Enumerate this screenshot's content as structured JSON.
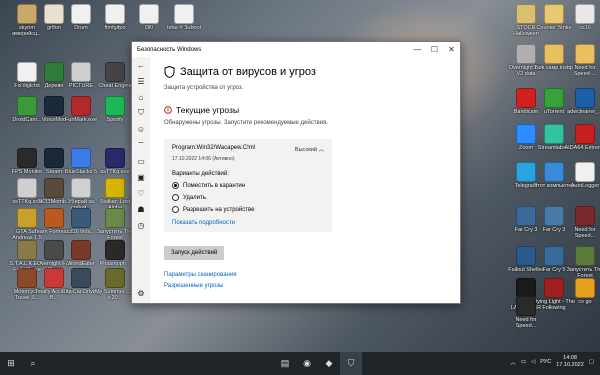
{
  "desktop": {
    "icons": [
      {
        "label": "skyrim имерийсц...",
        "color": "#c9a86a"
      },
      {
        "label": "grlfon",
        "color": "#e8e0d0"
      },
      {
        "label": "Drum",
        "color": "#f0f0f0"
      },
      {
        "label": "ftmfgifpo",
        "color": "#f0f0f0"
      },
      {
        "label": "l3l0",
        "color": "#f0f0f0"
      },
      {
        "label": "tsfac'# 3ubnol",
        "color": "#f0f0f0"
      },
      {
        "label": "STOCR Halloween",
        "color": "#d9c070"
      },
      {
        "label": "Counter Strike",
        "color": "#e8c870"
      },
      {
        "label": "cs16",
        "color": "#e8e8e8"
      },
      {
        "label": "Overnight Full V2 data",
        "color": "#b0b0b0"
      },
      {
        "label": "Бок самр.insttp",
        "color": "#e8c060"
      },
      {
        "label": "Need for Speed-...",
        "color": "#e8c060"
      },
      {
        "label": "Fix'diglctxt",
        "color": "#f0f0f0"
      },
      {
        "label": "Дерево",
        "color": "#2f7d3a"
      },
      {
        "label": "PICTURE",
        "color": "#cfcfcf"
      },
      {
        "label": "Cheat Engine",
        "color": "#444444"
      },
      {
        "label": "Bandicam",
        "color": "#d02020"
      },
      {
        "label": "uTorrent",
        "color": "#36a33a"
      },
      {
        "label": "adwcleaner_...",
        "color": "#1b5fa8"
      },
      {
        "label": "DroidCam...",
        "color": "#3a9a3a"
      },
      {
        "label": "VoiceMod",
        "color": "#1a2a3a"
      },
      {
        "label": "FunMark.exe",
        "color": "#b02a2a"
      },
      {
        "label": "Spotify",
        "color": "#1db954"
      },
      {
        "label": "Zoom",
        "color": "#2d8cff"
      },
      {
        "label": "Streamlabs...",
        "color": "#31c3a2"
      },
      {
        "label": "AIDA64 Extreme",
        "color": "#c42020"
      },
      {
        "label": "FPS Monitor",
        "color": "#2a2a2a"
      },
      {
        "label": "Steam",
        "color": "#1b2838"
      },
      {
        "label": "BlueStacks 5",
        "color": "#3b7be8"
      },
      {
        "label": "ssTTKq.exe",
        "color": "#2a2a6a"
      },
      {
        "label": "Telegram",
        "color": "#2aa3e0"
      },
      {
        "label": "Этот компьютер",
        "color": "#3a8ad8"
      },
      {
        "label": "AutoLogger",
        "color": "#f0f0f0"
      },
      {
        "label": "ssTTKq.exe",
        "color": "#cfcfcf"
      },
      {
        "label": "ЗКЗЗМоmb...",
        "color": "#5a4a3a"
      },
      {
        "label": "Убирай за собой...",
        "color": "#d0d0d0"
      },
      {
        "label": "Stalker: Lost Alpha",
        "color": "#d6b400"
      },
      {
        "label": "Far Cry 3",
        "color": "#3a6a9a"
      },
      {
        "label": "Far Cry 3",
        "color": "#4a7aaa"
      },
      {
        "label": "Need for Speed...",
        "color": "#7a2a2a"
      },
      {
        "label": "GTA San Andreas 1.5",
        "color": "#c8a030"
      },
      {
        "label": "Team Fortress 2",
        "color": "#b85a20"
      },
      {
        "label": "cs16 hlds...",
        "color": "#3a5a7a"
      },
      {
        "label": "Запустить The Forest",
        "color": "#6a8a4a"
      },
      {
        "label": "S.T.A.L.K.E.R. Full V2.exe",
        "color": "#8a7a4a"
      },
      {
        "label": "Overnight Full V2.exe",
        "color": "#4a4a4a"
      },
      {
        "label": "WorldEater",
        "color": "#7a3a2a"
      },
      {
        "label": "Phasmoph...",
        "color": "#2a2a2a"
      },
      {
        "label": "Fallout Shelter",
        "color": "#2a5a8a"
      },
      {
        "label": "Far Cry 5",
        "color": "#3a6a9a"
      },
      {
        "label": "Запустить The Forest",
        "color": "#5a7a3a"
      },
      {
        "label": "Motorcycle Travel S...",
        "color": "#8a4a2a"
      },
      {
        "label": "Totally Accurate B...",
        "color": "#c83a3a"
      },
      {
        "label": "City Car Driving",
        "color": "#3a4a5a"
      },
      {
        "label": "My Summer Car v.20...",
        "color": "#6a6a2a"
      },
      {
        "label": "RAZMIR LAUNCHER",
        "color": "#1a1a1a"
      },
      {
        "label": "Dying Light - The Following",
        "color": "#a02020"
      },
      {
        "label": "cs go",
        "color": "#e8a020"
      },
      {
        "label": "Need for Speed...",
        "color": "#2a2a2a"
      }
    ]
  },
  "window": {
    "title": "Безопасность Windows",
    "minimize_icon": "minimize-icon",
    "maximize_icon": "maximize-icon",
    "close_icon": "close-icon",
    "heading": "Защита от вирусов и угроз",
    "subtitle": "Защита устройства от угроз.",
    "section_title": "Текущие угрозы",
    "section_desc": "Обнаружены угрозы. Запустите рекомендуемые действия.",
    "threat": {
      "name": "Program:Win32/Wacapew.C!ml",
      "severity": "Высокий",
      "date": "17.10.2022 14:06 (Активно)",
      "options_label": "Варианты действий:",
      "options": [
        {
          "label": "Поместить в карантин",
          "selected": true
        },
        {
          "label": "Удалить",
          "selected": false
        },
        {
          "label": "Разрешить на устройстве",
          "selected": false
        }
      ],
      "details_link": "Показать подробности"
    },
    "start_button": "Запуск действий",
    "scan_options_link": "Параметры сканирования",
    "allowed_threats_link": "Разрешенные угрозы"
  },
  "taskbar": {
    "lang": "РУС",
    "time": "14:08",
    "date": "17.10.2022"
  },
  "colors": {
    "link": "#0067c0",
    "taskbar": "#1f2428"
  }
}
